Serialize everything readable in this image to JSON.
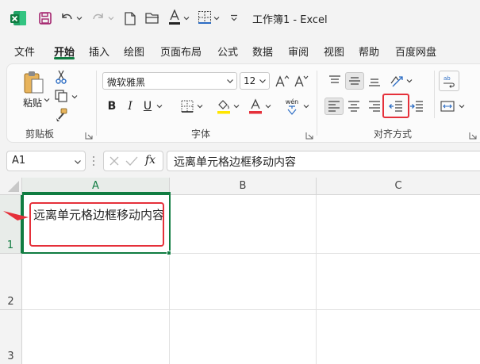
{
  "window": {
    "title": "工作簿1  -  Excel"
  },
  "menu": {
    "tabs": [
      {
        "label": "文件",
        "active": false
      },
      {
        "label": "开始",
        "active": true
      },
      {
        "label": "插入",
        "active": false
      },
      {
        "label": "绘图",
        "active": false
      },
      {
        "label": "页面布局",
        "active": false
      },
      {
        "label": "公式",
        "active": false
      },
      {
        "label": "数据",
        "active": false
      },
      {
        "label": "审阅",
        "active": false
      },
      {
        "label": "视图",
        "active": false
      },
      {
        "label": "帮助",
        "active": false
      },
      {
        "label": "百度网盘",
        "active": false
      }
    ]
  },
  "ribbon": {
    "clipboard": {
      "paste_label": "粘贴",
      "group_label": "剪贴板"
    },
    "font": {
      "font_name": "微软雅黑",
      "font_size": "12",
      "group_label": "字体",
      "bold": "B",
      "italic": "I",
      "underline": "U",
      "phonetic": "wén"
    },
    "alignment": {
      "group_label": "对齐方式"
    }
  },
  "formula_bar": {
    "name_box": "A1",
    "fx_label": "fx",
    "formula": "远离单元格边框移动内容"
  },
  "sheet": {
    "columns": [
      "A",
      "B",
      "C"
    ],
    "rows": [
      "1",
      "2",
      "3"
    ],
    "cells": {
      "A1": "远离单元格边框移动内容"
    }
  },
  "colors": {
    "accent": "#107c41",
    "highlight": "#e5303a"
  }
}
